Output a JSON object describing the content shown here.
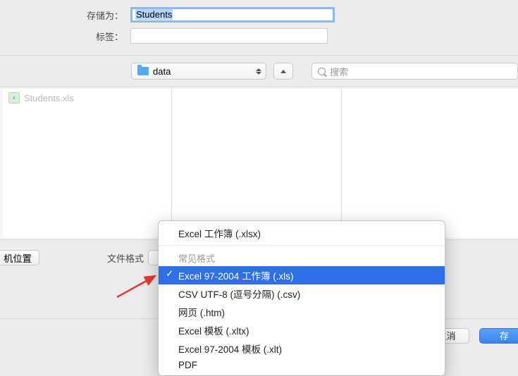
{
  "form": {
    "save_as_label": "存储为：",
    "save_as_value": "Students",
    "tags_label": "标签："
  },
  "location": {
    "folder": "data",
    "search_placeholder": "搜索"
  },
  "columns": {
    "items": [
      "Students.xls"
    ]
  },
  "bottom": {
    "location_btn": "机位置",
    "format_label": "文件格式"
  },
  "dropdown": {
    "top_item": "Excel 工作簿 (.xlsx)",
    "group": "常见格式",
    "items": [
      "Excel 97-2004 工作簿 (.xls)",
      "CSV UTF-8 (逗号分隔) (.csv)",
      "网页 (.htm)",
      "Excel 模板 (.xltx)",
      "Excel 97-2004 模板 (.xlt)",
      "PDF"
    ],
    "selected_index": 0,
    "check": "✓"
  },
  "footer": {
    "cancel": "取消",
    "save": "存"
  }
}
